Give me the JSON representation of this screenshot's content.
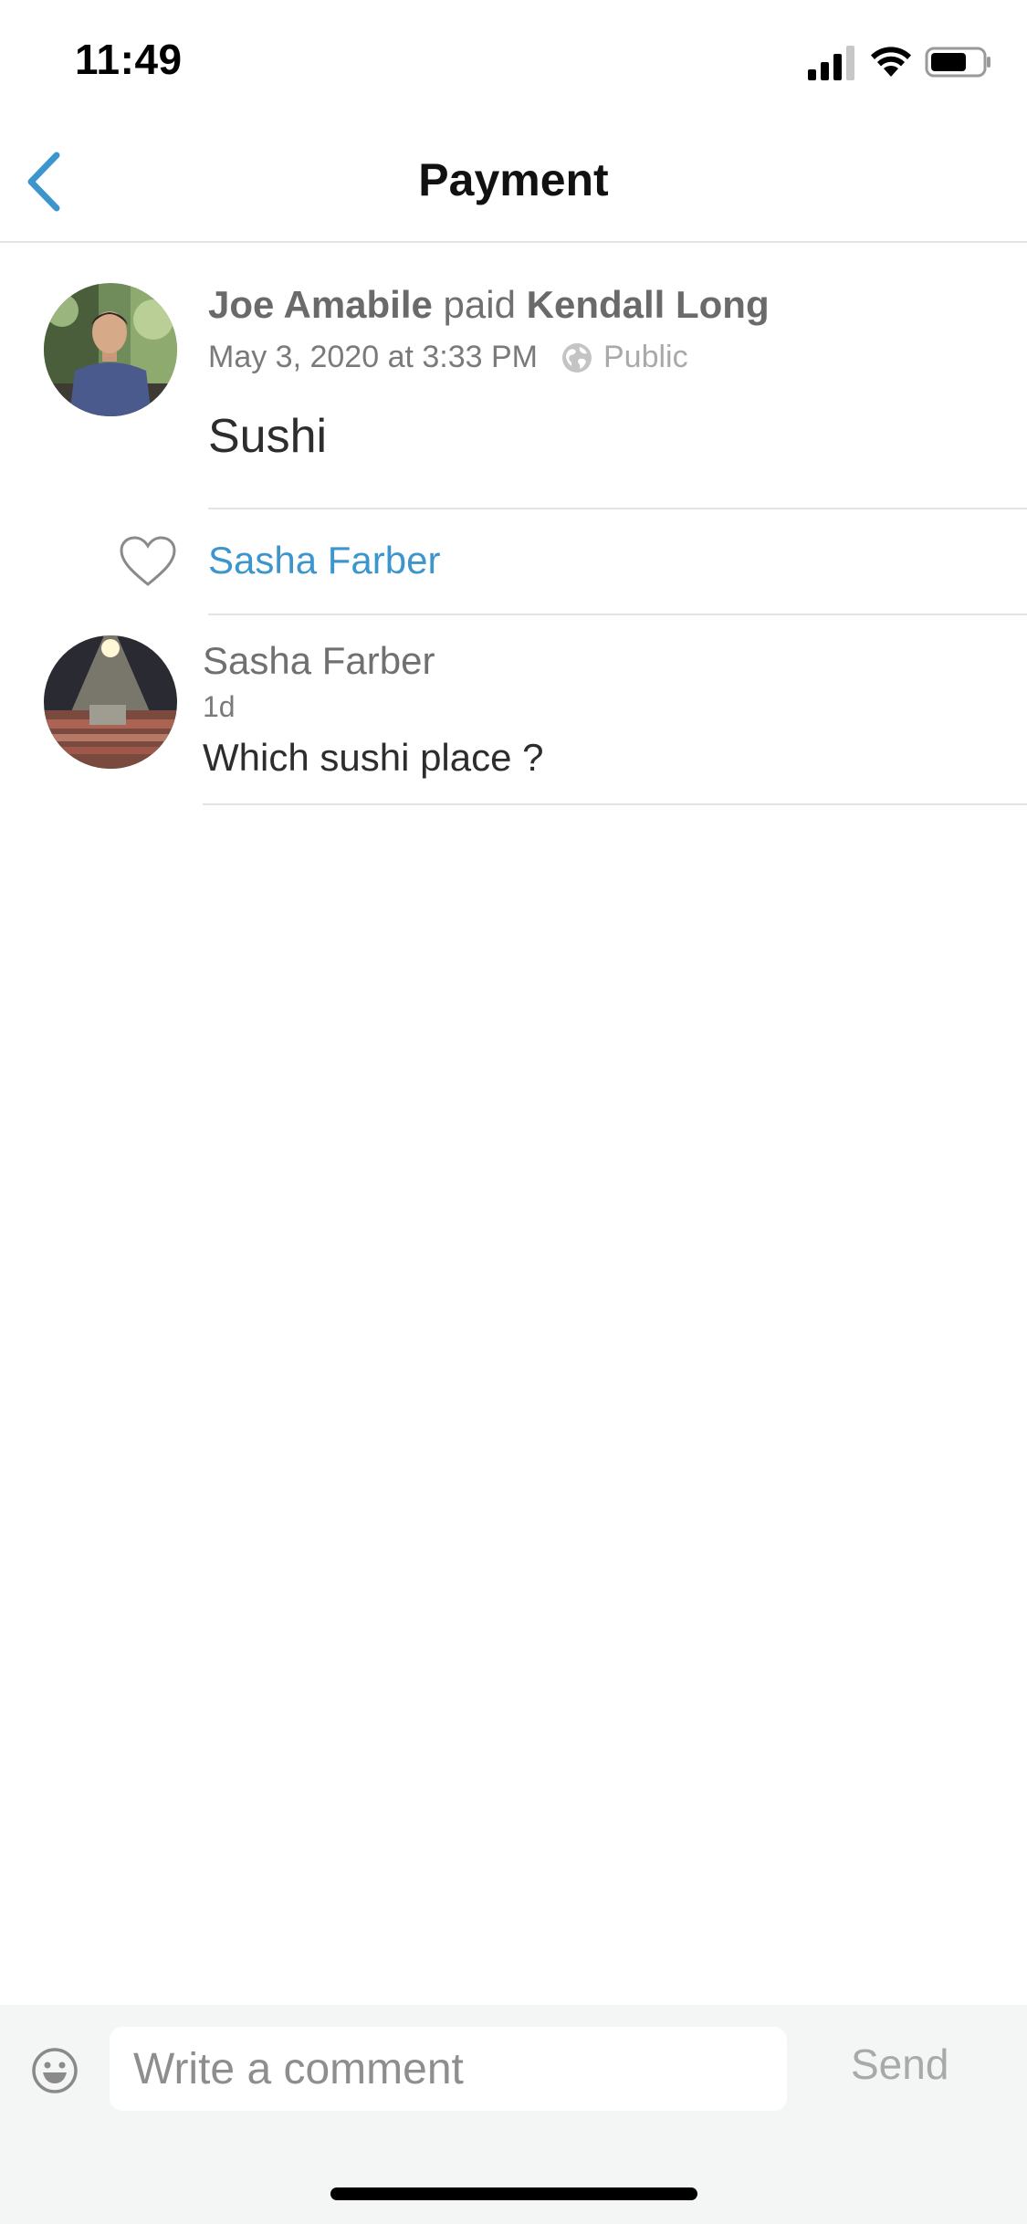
{
  "status_bar": {
    "time": "11:49",
    "icons": [
      "cellular-signal-icon",
      "wifi-icon",
      "battery-icon"
    ],
    "battery_level": 0.7
  },
  "nav": {
    "title": "Payment",
    "back_icon": "chevron-left-icon"
  },
  "story": {
    "payer": "Joe Amabile",
    "action": "paid",
    "payee": "Kendall Long",
    "date": "May 3, 2020 at 3:33 PM",
    "visibility_icon": "globe-icon",
    "visibility": "Public",
    "note": "Sushi"
  },
  "likes": {
    "icon": "heart-icon",
    "names": "Sasha Farber"
  },
  "comments": [
    {
      "author": "Sasha Farber",
      "time": "1d",
      "text": "Which sushi place ?"
    }
  ],
  "composer": {
    "emoji_icon": "smiley-icon",
    "placeholder": "Write a comment",
    "send_label": "Send"
  },
  "colors": {
    "accent": "#3d95ce",
    "divider": "#e3e3e3",
    "composer_bg": "#f4f5f5"
  }
}
